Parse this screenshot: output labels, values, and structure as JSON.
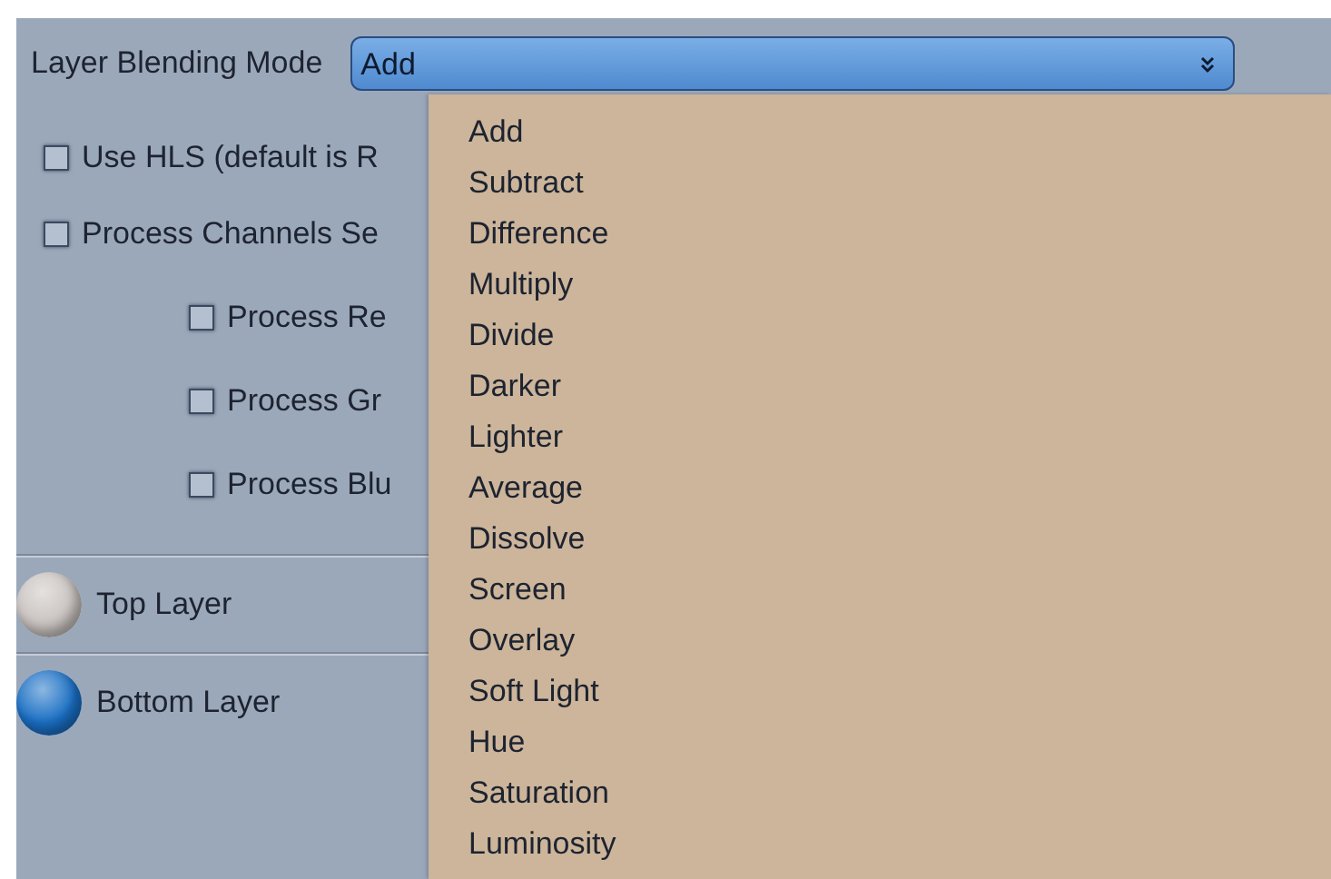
{
  "blend_mode": {
    "label": "Layer Blending Mode",
    "value": "Add",
    "expanded": true
  },
  "options": [
    {
      "label": "Use HLS (default is R",
      "checked": false
    },
    {
      "label": "Process Channels Se",
      "checked": false
    }
  ],
  "channel_options": [
    {
      "label": "Process Re",
      "checked": false
    },
    {
      "label": "Process Gr",
      "checked": false
    },
    {
      "label": "Process Blu",
      "checked": false
    }
  ],
  "layers": [
    {
      "name": "Top Layer",
      "color": "#c9c3c0"
    },
    {
      "name": "Bottom Layer",
      "color": "#1a6fc4"
    }
  ],
  "menu_items": [
    "Add",
    "Subtract",
    "Difference",
    "Multiply",
    "Divide",
    "Darker",
    "Lighter",
    "Average",
    "Dissolve",
    "Screen",
    "Overlay",
    "Soft Light",
    "Hue",
    "Saturation",
    "Luminosity"
  ]
}
